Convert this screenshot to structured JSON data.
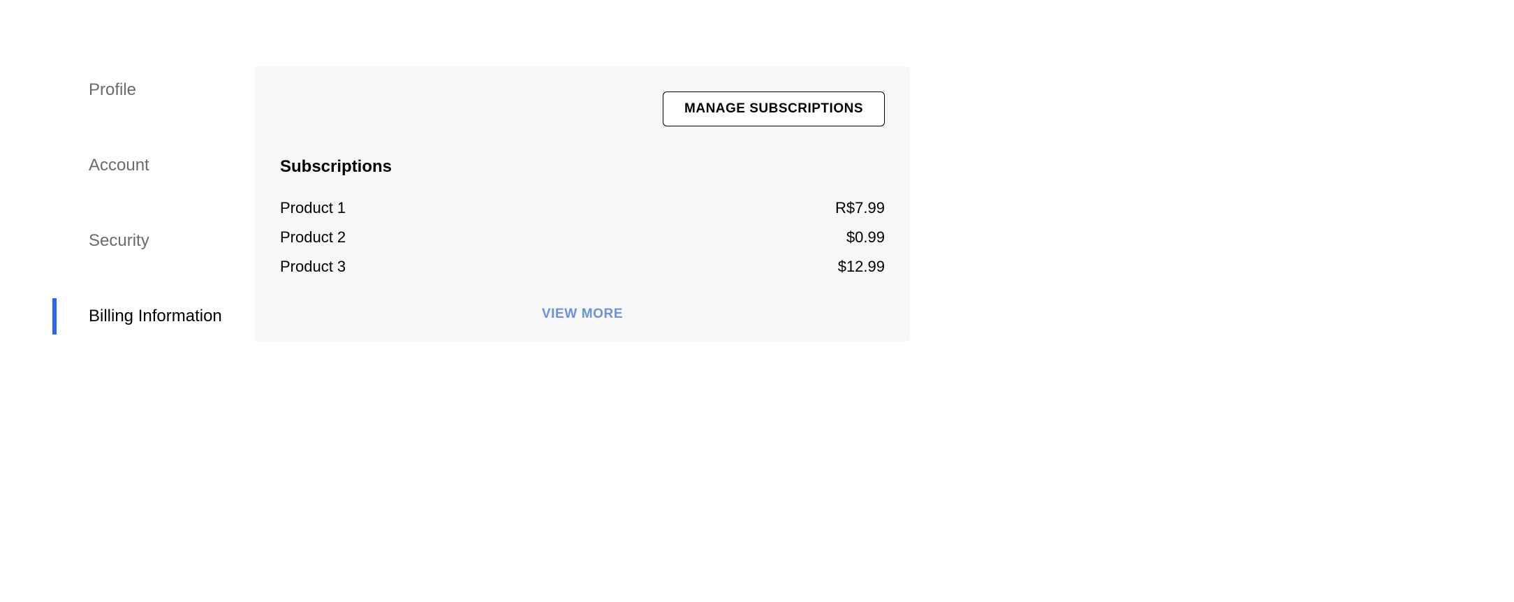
{
  "sidebar": {
    "items": [
      {
        "label": "Profile"
      },
      {
        "label": "Account"
      },
      {
        "label": "Security"
      },
      {
        "label": "Billing Information"
      }
    ]
  },
  "card": {
    "manage_label": "MANAGE SUBSCRIPTIONS",
    "section_title": "Subscriptions",
    "products": [
      {
        "name": "Product 1",
        "price": "R$7.99"
      },
      {
        "name": "Product 2",
        "price": "$0.99"
      },
      {
        "name": "Product 3",
        "price": "$12.99"
      }
    ],
    "view_more_label": "VIEW MORE"
  }
}
